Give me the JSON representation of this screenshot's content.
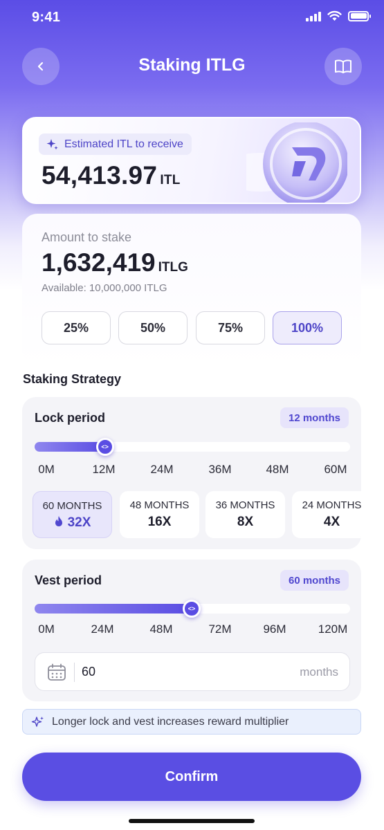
{
  "status_bar": {
    "time": "9:41"
  },
  "header": {
    "title": "Staking ITLG"
  },
  "estimate": {
    "badge": "Estimated ITL to receive",
    "value": "54,413.97",
    "unit": "ITL"
  },
  "stake": {
    "label": "Amount to stake",
    "value": "1,632,419",
    "unit": "ITLG",
    "available": "Available: 10,000,000 ITLG",
    "percent_options": [
      "25%",
      "50%",
      "75%",
      "100%"
    ],
    "selected_percent": "100%"
  },
  "strategy": {
    "title": "Staking Strategy",
    "lock": {
      "title": "Lock period",
      "pill": "12 months",
      "slider_value_months": 12,
      "slider_max_months": 60,
      "ticks": [
        "0M",
        "12M",
        "24M",
        "36M",
        "48M",
        "60M"
      ],
      "multipliers": [
        {
          "months": "60 MONTHS",
          "value": "32X",
          "selected": true
        },
        {
          "months": "48 MONTHS",
          "value": "16X",
          "selected": false
        },
        {
          "months": "36 MONTHS",
          "value": "8X",
          "selected": false
        },
        {
          "months": "24 MONTHS",
          "value": "4X",
          "selected": false
        }
      ]
    },
    "vest": {
      "title": "Vest period",
      "pill": "60 months",
      "slider_value_months": 60,
      "slider_max_months": 120,
      "ticks": [
        "0M",
        "24M",
        "48M",
        "72M",
        "96M",
        "120M"
      ],
      "input_value": "60",
      "input_unit": "months"
    }
  },
  "hint": "Longer lock and vest increases reward multiplier",
  "confirm_label": "Confirm",
  "colors": {
    "accent": "#5a4ee3",
    "accent_light": "#e8e6fb",
    "hint_bg": "#eaf0fd"
  }
}
